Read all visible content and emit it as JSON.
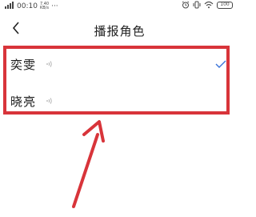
{
  "status_bar": {
    "time": "00:10",
    "net_speed_value": "7.40",
    "net_speed_unit": "KB/s",
    "more": "···",
    "battery": "100"
  },
  "nav": {
    "title": "播报角色"
  },
  "roles": [
    {
      "name": "奕雯",
      "selected": true
    },
    {
      "name": "晓亮",
      "selected": false
    }
  ],
  "colors": {
    "highlight": "#d8343a",
    "check": "#3b73d9"
  }
}
